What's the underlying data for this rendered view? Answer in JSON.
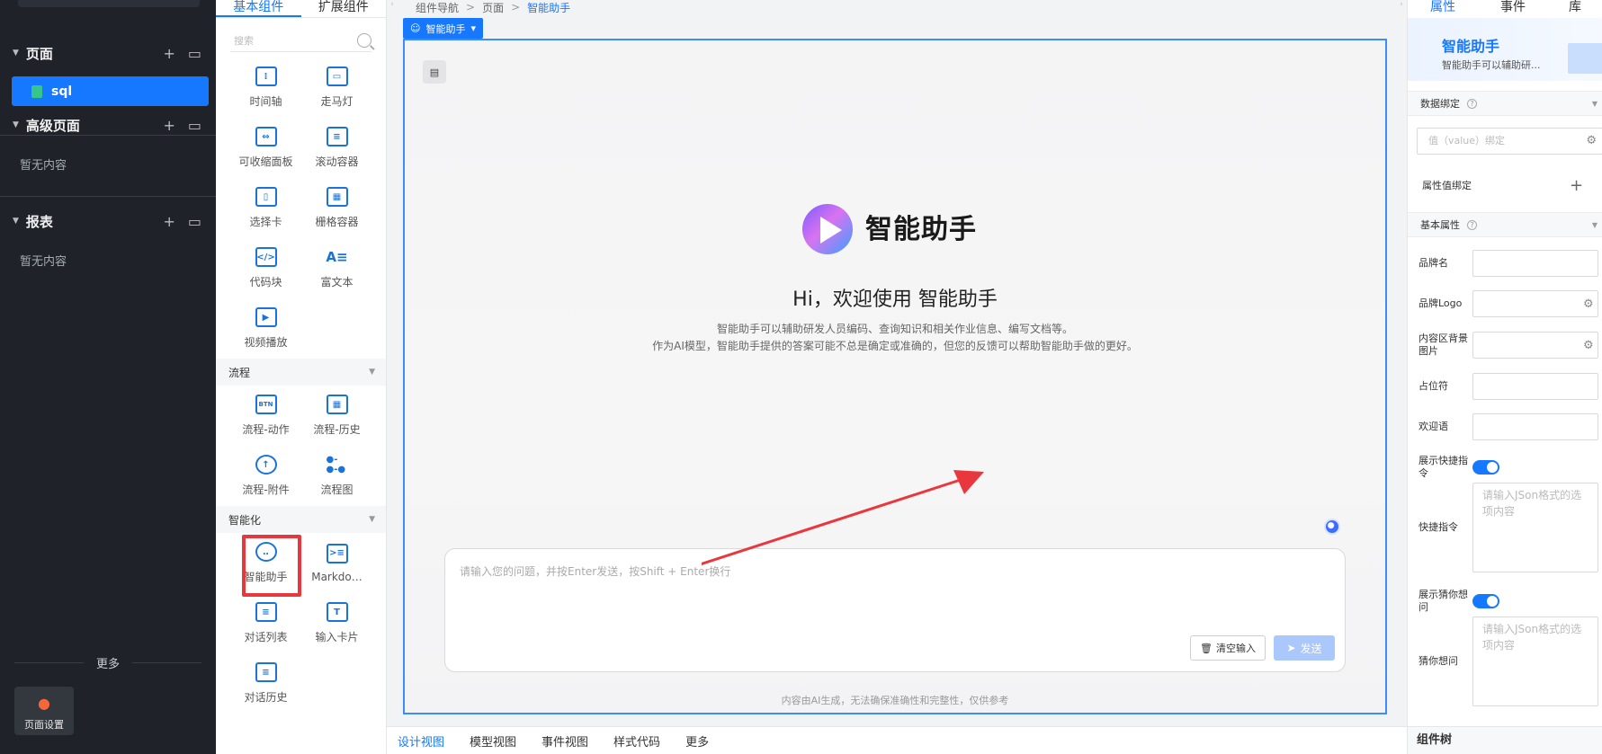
{
  "left_nav": {
    "sections": [
      {
        "title": "页面",
        "items": [
          "sql"
        ],
        "empty": ""
      },
      {
        "title": "高级页面",
        "items": [],
        "empty": "暂无内容"
      },
      {
        "title": "报表",
        "items": [],
        "empty": "暂无内容"
      }
    ],
    "more_label": "更多",
    "page_settings_label": "页面设置"
  },
  "palette": {
    "tabs": [
      "基本组件",
      "扩展组件"
    ],
    "search_placeholder": "搜索",
    "basic_items": [
      "时间轴",
      "走马灯",
      "可收缩面板",
      "滚动容器",
      "选择卡",
      "栅格容器",
      "代码块",
      "富文本",
      "视频播放"
    ],
    "groups": [
      {
        "title": "流程",
        "items": [
          "流程-动作",
          "流程-历史",
          "流程-附件",
          "流程图"
        ]
      },
      {
        "title": "智能化",
        "items": [
          "智能助手",
          "Markdo…",
          "对话列表",
          "输入卡片",
          "对话历史"
        ]
      }
    ]
  },
  "canvas": {
    "breadcrumb": [
      "组件导航",
      "页面",
      "智能助手"
    ],
    "selected_tag": "智能助手",
    "assistant": {
      "brand_name": "智能助手",
      "greeting": "Hi，欢迎使用 智能助手",
      "intro_line1": "智能助手可以辅助研发人员编码、查询知识和相关作业信息、编写文档等。",
      "intro_line2": "作为AI模型，智能助手提供的答案可能不总是确定或准确的，但您的反馈可以帮助智能助手做的更好。",
      "input_placeholder": "请输入您的问题，并按Enter发送，按Shift + Enter换行",
      "clear_label": "清空输入",
      "send_label": "发送",
      "disclaimer": "内容由AI生成，无法确保准确性和完整性，仅供参考"
    },
    "bottom_tabs": [
      "设计视图",
      "模型视图",
      "事件视图",
      "样式代码",
      "更多"
    ]
  },
  "right_panel": {
    "tabs": [
      "属性",
      "事件",
      "库"
    ],
    "hero_title": "智能助手",
    "hero_desc": "智能助手可以辅助研...",
    "data_binding_label": "数据绑定",
    "value_binding_placeholder": "值（value）绑定",
    "attr_binding_label": "属性值绑定",
    "basic_props_label": "基本属性",
    "fields": {
      "brand_name": "品牌名",
      "brand_logo": "品牌Logo",
      "content_bg": "内容区背景图片",
      "placeholder": "占位符",
      "welcome": "欢迎语",
      "show_shortcuts": "展示快捷指令",
      "shortcuts": "快捷指令",
      "show_guess": "展示猜你想问",
      "guess": "猜你想问"
    },
    "json_placeholder": "请输入JSon格式的选项内容",
    "footer": "组件树"
  },
  "colors": {
    "accent": "#1677ff",
    "sidebar_bg": "#1f2329",
    "highlight_red": "#e8383d"
  }
}
